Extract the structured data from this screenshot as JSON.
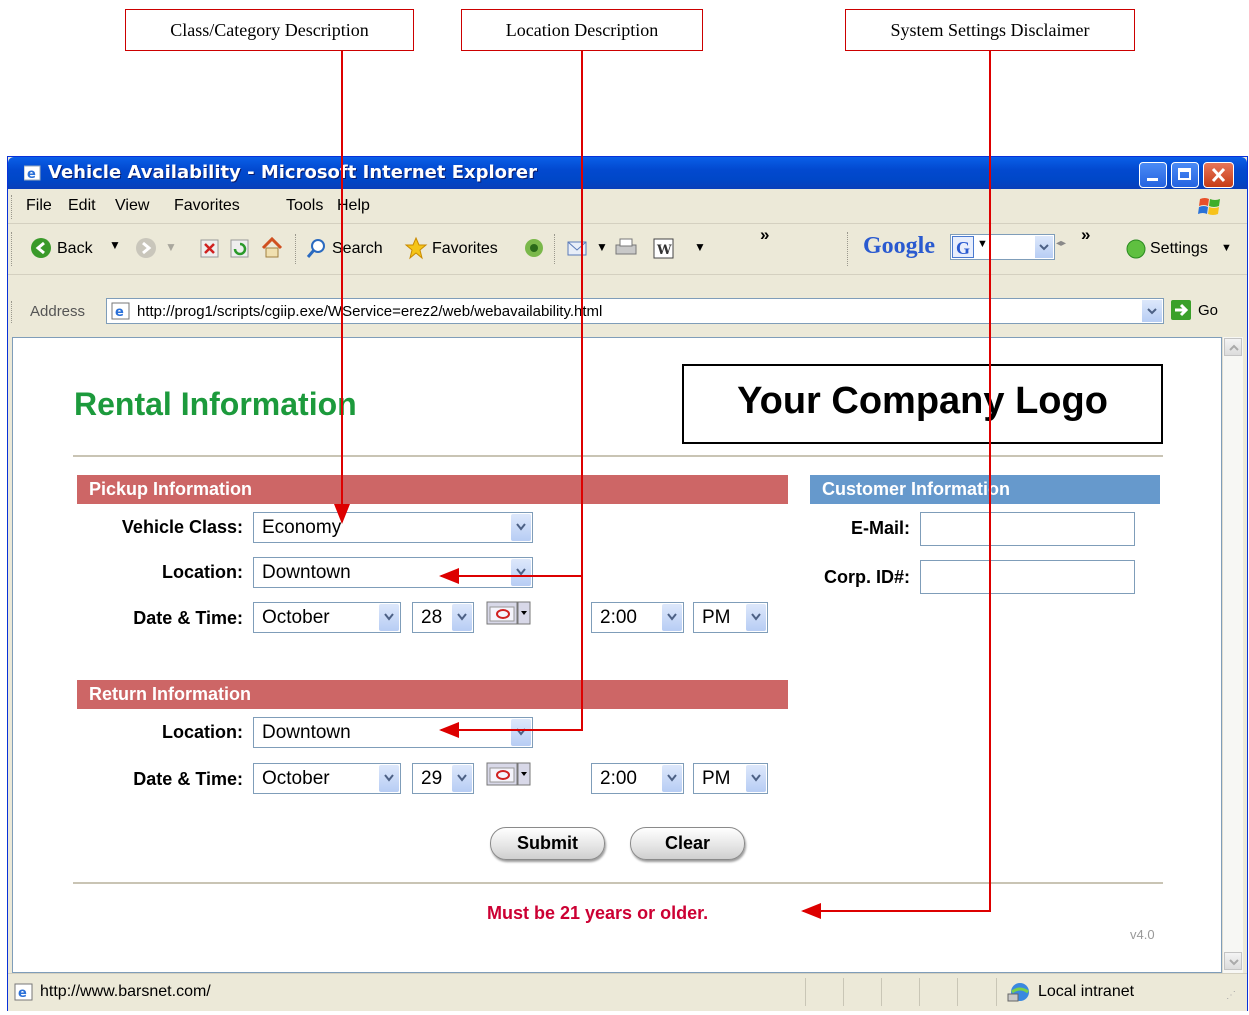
{
  "callouts": {
    "class_category": "Class/Category Description",
    "location": "Location Description",
    "system_settings": "System Settings Disclaimer"
  },
  "window": {
    "title": "Vehicle Availability - Microsoft Internet Explorer"
  },
  "menu": [
    "File",
    "Edit",
    "View",
    "Favorites",
    "Tools",
    "Help"
  ],
  "toolbar": {
    "back": "Back",
    "search": "Search",
    "favorites": "Favorites",
    "google": "Google",
    "settings": "Settings",
    "chevron": "»"
  },
  "address": {
    "label": "Address",
    "url": "http://prog1/scripts/cgiip.exe/WService=erez2/web/webavailability.html",
    "go": "Go"
  },
  "page": {
    "title": "Rental Information",
    "logo": "Your Company Logo",
    "pickup": {
      "header": "Pickup Information",
      "vehicle_class_label": "Vehicle Class:",
      "vehicle_class_value": "Economy",
      "location_label": "Location:",
      "location_value": "Downtown",
      "datetime_label": "Date & Time:",
      "month": "October",
      "day": "28",
      "time": "2:00",
      "ampm": "PM"
    },
    "return": {
      "header": "Return Information",
      "location_label": "Location:",
      "location_value": "Downtown",
      "datetime_label": "Date & Time:",
      "month": "October",
      "day": "29",
      "time": "2:00",
      "ampm": "PM"
    },
    "customer": {
      "header": "Customer Information",
      "email_label": "E-Mail:",
      "email_value": "",
      "corp_label": "Corp. ID#:",
      "corp_value": ""
    },
    "submit": "Submit",
    "clear": "Clear",
    "disclaimer": "Must be 21 years or older.",
    "version": "v4.0"
  },
  "status": {
    "url": "http://www.barsnet.com/",
    "zone": "Local intranet"
  },
  "colors": {
    "title_green": "#1C9A3C",
    "red_header": "#CD6666",
    "blue_header": "#6699CC",
    "disclaimer_red": "#CC0033",
    "callout_line": "#DD0000"
  }
}
